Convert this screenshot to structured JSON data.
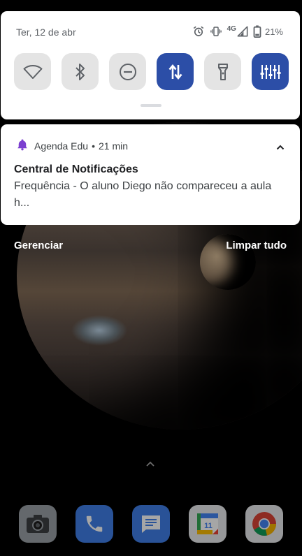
{
  "status": {
    "date": "Ter, 12 de abr",
    "network": "4G",
    "battery": "21%",
    "icons": [
      "alarm-icon",
      "vibrate-icon",
      "signal-icon",
      "battery-icon"
    ]
  },
  "quick_tiles": [
    {
      "name": "wifi",
      "icon": "wifi-icon",
      "active": false
    },
    {
      "name": "bluetooth",
      "icon": "bluetooth-icon",
      "active": false
    },
    {
      "name": "do-not-disturb",
      "icon": "dnd-icon",
      "active": false
    },
    {
      "name": "mobile-data",
      "icon": "data-arrows-icon",
      "active": true
    },
    {
      "name": "flashlight",
      "icon": "flashlight-icon",
      "active": false
    },
    {
      "name": "equalizer",
      "icon": "equalizer-icon",
      "active": true
    }
  ],
  "notification": {
    "app": "Agenda Edu",
    "separator": "•",
    "time": "21 min",
    "title": "Central de Notificações",
    "body": "Frequência - O aluno Diego não compareceu a aula h...",
    "accent": "#7b3fd0"
  },
  "actions": {
    "manage": "Gerenciar",
    "clear_all": "Limpar tudo"
  },
  "dock": {
    "calendar_day": "11",
    "apps": [
      "camera",
      "phone",
      "messages",
      "calendar",
      "chrome"
    ]
  },
  "colors": {
    "tile_active": "#2c4ea7",
    "tile_inactive": "#e4e4e4"
  }
}
